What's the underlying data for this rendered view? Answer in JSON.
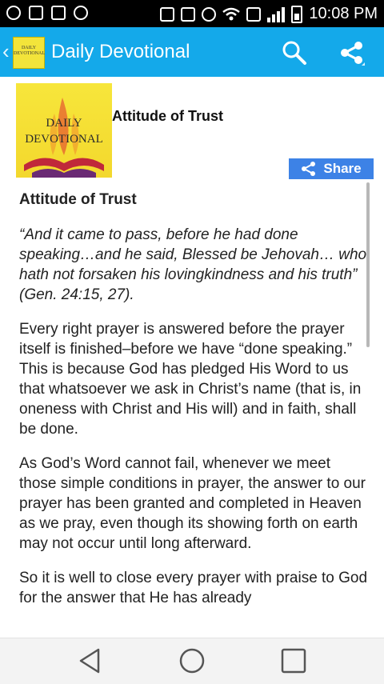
{
  "status_bar": {
    "time": "10:08 PM",
    "icons": [
      "messenger-icon",
      "image-icon",
      "battery-saver-icon",
      "usb-icon",
      "nfc-icon",
      "vibrate-icon",
      "alarm-icon",
      "wifi-icon",
      "data-icon",
      "signal-icon",
      "battery-icon"
    ]
  },
  "app_bar": {
    "title": "Daily Devotional",
    "logo_text_line1": "DAILY",
    "logo_text_line2": "DEVOTIONAL",
    "actions": [
      "search-icon",
      "share-icon"
    ],
    "color": "#14a9ea"
  },
  "devotional": {
    "thumbnail_line1": "DAILY",
    "thumbnail_line2": "DEVOTIONAL",
    "header_title": "Attitude of Trust",
    "share_label": "Share",
    "share_color": "#3d82e6",
    "article_title": "Attitude of Trust",
    "quote": "“And it came to pass, before he had done speaking…and he said, Blessed be Jehovah… who hath not forsaken his lovingkindness and his truth” (Gen. 24:15, 27).",
    "paragraphs": [
      "Every right prayer is answered before the prayer itself is finished–before we have “done speaking.” This is because God has pledged His Word to us that whatsoever we ask in Christ’s name (that is, in oneness with Christ and His will) and in faith, shall be done.",
      "As God’s Word cannot fail, whenever we meet those simple conditions in prayer, the answer to our prayer has been granted and completed in Heaven as we pray, even though its showing forth on earth may not occur until long afterward.",
      "So it is well to close every prayer with praise to God for the answer that He has already"
    ]
  },
  "nav_bar": {
    "buttons": [
      "back-icon",
      "home-icon",
      "recents-icon"
    ]
  }
}
